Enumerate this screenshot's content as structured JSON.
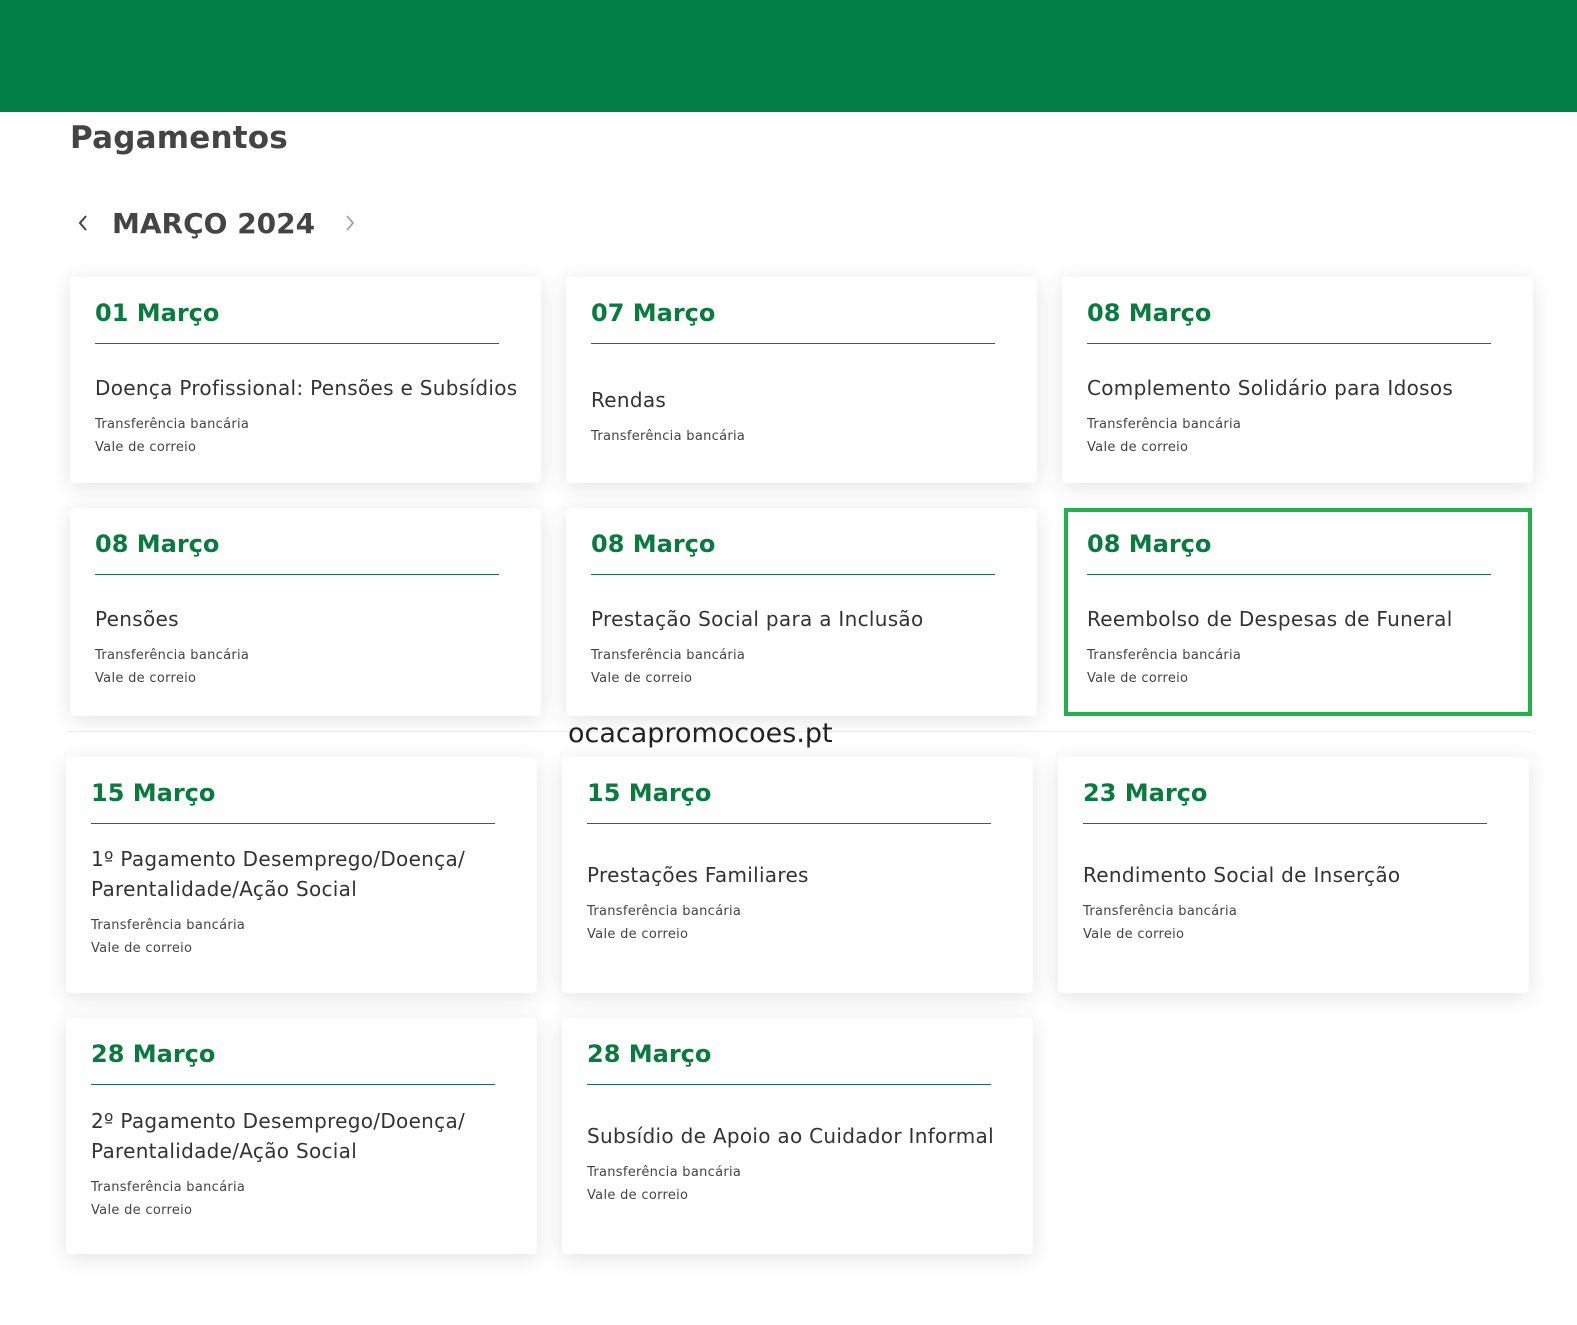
{
  "header": {
    "page_title": "Pagamentos"
  },
  "month_nav": {
    "label": "MARÇO 2024",
    "prev_icon": "chevron-left-icon",
    "next_icon": "chevron-right-icon"
  },
  "colors": {
    "brand_green": "#007f45",
    "date_green": "#0a7a3e",
    "highlight": "#22b14c"
  },
  "watermark": "ocacapromocoes.pt",
  "cards": [
    {
      "date": "01 Março",
      "title": "Doença Profissional: Pensões e Subsídios",
      "methods": [
        "Transferência bancária",
        "Vale de correio"
      ]
    },
    {
      "date": "07 Março",
      "title": "Rendas",
      "methods": [
        "Transferência bancária"
      ]
    },
    {
      "date": "08 Março",
      "title": "Complemento Solidário para Idosos",
      "methods": [
        "Transferência bancária",
        "Vale de correio"
      ]
    },
    {
      "date": "08 Março",
      "title": "Pensões",
      "methods": [
        "Transferência bancária",
        "Vale de correio"
      ]
    },
    {
      "date": "08 Março",
      "title": "Prestação Social para a Inclusão",
      "methods": [
        "Transferência bancária",
        "Vale de correio"
      ]
    },
    {
      "date": "08 Março",
      "title": "Reembolso de Despesas de Funeral",
      "methods": [
        "Transferência bancária",
        "Vale de correio"
      ]
    },
    {
      "date": "15 Março",
      "title": "1º Pagamento Desemprego/Doença/ Parentalidade/Ação Social",
      "methods": [
        "Transferência bancária",
        "Vale de correio"
      ]
    },
    {
      "date": "15 Março",
      "title": "Prestações Familiares",
      "methods": [
        "Transferência bancária",
        "Vale de correio"
      ]
    },
    {
      "date": "23 Março",
      "title": "Rendimento Social de Inserção",
      "methods": [
        "Transferência bancária",
        "Vale de correio"
      ]
    },
    {
      "date": "28 Março",
      "title": "2º Pagamento Desemprego/Doença/ Parentalidade/Ação Social",
      "methods": [
        "Transferência bancária",
        "Vale de correio"
      ]
    },
    {
      "date": "28 Março",
      "title": "Subsídio de Apoio ao Cuidador Informal",
      "methods": [
        "Transferência bancária",
        "Vale de correio"
      ]
    }
  ]
}
